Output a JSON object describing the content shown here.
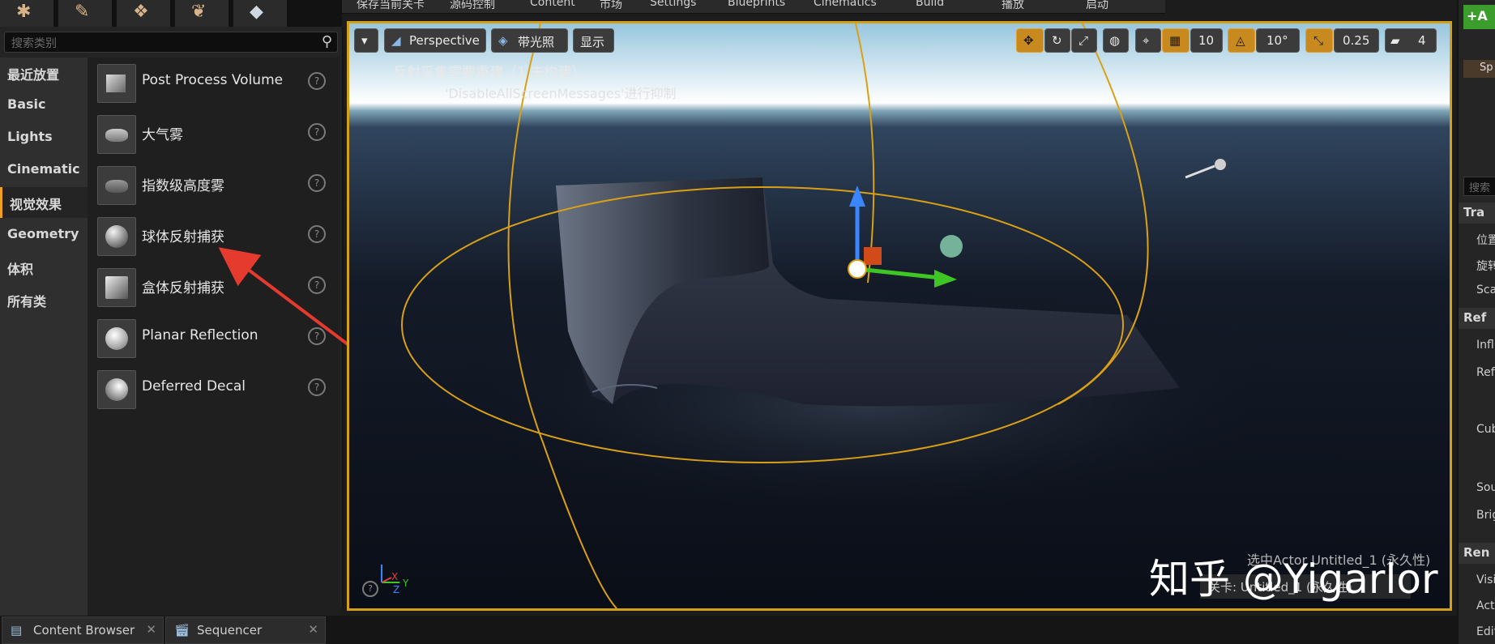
{
  "mode_tabs": [
    "place-icon",
    "paint-icon",
    "landscape-icon",
    "foliage-icon",
    "geometry-icon"
  ],
  "search": {
    "placeholder": "搜索类别"
  },
  "categories": [
    {
      "label": "最近放置"
    },
    {
      "label": "Basic"
    },
    {
      "label": "Lights"
    },
    {
      "label": "Cinematic"
    },
    {
      "label": "视觉效果",
      "active": true
    },
    {
      "label": "Geometry"
    },
    {
      "label": "体积"
    },
    {
      "label": "所有类"
    }
  ],
  "items": [
    {
      "label": "Post Process Volume",
      "icon": "post-process-volume-icon"
    },
    {
      "label": "大气雾",
      "icon": "atmospheric-fog-icon"
    },
    {
      "label": "指数级高度雾",
      "icon": "exponential-height-fog-icon"
    },
    {
      "label": "球体反射捕获",
      "icon": "sphere-reflection-capture-icon"
    },
    {
      "label": "盒体反射捕获",
      "icon": "box-reflection-capture-icon"
    },
    {
      "label": "Planar Reflection",
      "icon": "planar-reflection-icon"
    },
    {
      "label": "Deferred Decal",
      "icon": "deferred-decal-icon"
    }
  ],
  "top_menu": [
    "保存当前关卡",
    "源码控制",
    "Content",
    "市场",
    "Settings",
    "Blueprints",
    "Cinematics",
    "Build",
    "播放",
    "启动"
  ],
  "viewport": {
    "perspective": "Perspective",
    "lit": "带光照",
    "show": "显示",
    "grid_snap": "10",
    "rotation_snap": "10°",
    "scale_snap": "0.25",
    "camera_speed": "4",
    "message1": "反射采集需要重建（1 未构建）",
    "message2": "'DisableAllScreenMessages'进行抑制",
    "axis_x": "X",
    "axis_y": "Y",
    "axis_z": "Z",
    "level_text": "选中Actor  Untitled_1 (永久性)",
    "level_label": "关卡:  Untitled_1 (永久性)"
  },
  "watermark": "知乎 @Yigarlor",
  "bottom_tabs": [
    {
      "label": "Content Browser",
      "icon": "content-browser-icon"
    },
    {
      "label": "Sequencer",
      "icon": "sequencer-icon"
    }
  ],
  "right_panel": {
    "add": "+A",
    "search_ph": "搜索",
    "actor": "Sp",
    "sections": [
      "Tra",
      "Ref",
      "Ren"
    ],
    "rows": [
      "位置",
      "旋转",
      "Sca",
      "Influ",
      "Refl",
      "Cub",
      "Sou",
      "Brig",
      "Visi",
      "Acti",
      "Edit"
    ]
  }
}
